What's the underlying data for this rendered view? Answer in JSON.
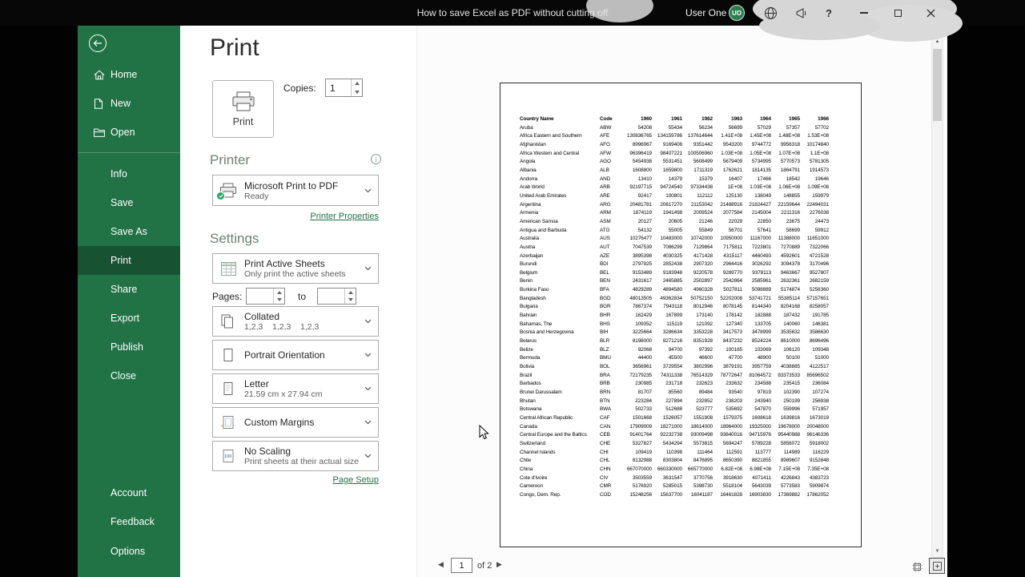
{
  "titlebar": {
    "title": "How to save Excel as PDF without cutting off",
    "user_name": "User One",
    "user_initials": "UO",
    "help_label": "?"
  },
  "sidebar": {
    "top": [
      {
        "label": "Home"
      },
      {
        "label": "New"
      },
      {
        "label": "Open"
      }
    ],
    "middle": [
      {
        "label": "Info"
      },
      {
        "label": "Save"
      },
      {
        "label": "Save As"
      },
      {
        "label": "Print"
      },
      {
        "label": "Share"
      },
      {
        "label": "Export"
      },
      {
        "label": "Publish"
      },
      {
        "label": "Close"
      }
    ],
    "bottom": [
      {
        "label": "Account"
      },
      {
        "label": "Feedback"
      },
      {
        "label": "Options"
      }
    ],
    "selected": "Print"
  },
  "print_panel": {
    "title": "Print",
    "print_button_label": "Print",
    "copies_label": "Copies:",
    "copies_value": "1",
    "printer_heading": "Printer",
    "printer_name": "Microsoft Print to PDF",
    "printer_status": "Ready",
    "printer_properties_link": "Printer Properties",
    "settings_heading": "Settings",
    "pages_label": "Pages:",
    "pages_to_label": "to",
    "pages_from_value": "",
    "pages_to_value": "",
    "dropdowns": [
      {
        "label": "Print Active Sheets",
        "sublabel": "Only print the active sheets"
      },
      {
        "label": "Collated",
        "sublabel": "1,2,3    1,2,3    1,2,3"
      },
      {
        "label": "Portrait Orientation",
        "sublabel": ""
      },
      {
        "label": "Letter",
        "sublabel": "21.59 cm x 27.94 cm"
      },
      {
        "label": "Custom Margins",
        "sublabel": ""
      },
      {
        "label": "No Scaling",
        "sublabel": "Print sheets at their actual size"
      }
    ],
    "page_setup_link": "Page Setup",
    "accent_color": "#217346"
  },
  "preview": {
    "nav": {
      "current_page": "1",
      "of_label": "of 2"
    },
    "table": {
      "headers": [
        "Country Name",
        "Code",
        "1960",
        "1961",
        "1962",
        "1963",
        "1964",
        "1965",
        "1966"
      ],
      "rows": [
        [
          "Aruba",
          "ABW",
          "54208",
          "55434",
          "56234",
          "56699",
          "57029",
          "57357",
          "57702"
        ],
        [
          "Africa Eastern and Southern",
          "AFE",
          "130836765",
          "134159786",
          "137614644",
          "1.41E+08",
          "1.45E+08",
          "1.48E+08",
          "1.53E+08"
        ],
        [
          "Afghanistan",
          "AFG",
          "8996967",
          "9169406",
          "9351442",
          "9543200",
          "9744772",
          "9956318",
          "10174840"
        ],
        [
          "Africa Western and Central",
          "AFW",
          "96396419",
          "98407221",
          "100506960",
          "1.03E+08",
          "1.05E+08",
          "1.07E+08",
          "1.1E+08"
        ],
        [
          "Angola",
          "AGO",
          "5454938",
          "5531451",
          "5608499",
          "5679409",
          "5734995",
          "5770573",
          "5781305"
        ],
        [
          "Albania",
          "ALB",
          "1608800",
          "1659800",
          "1711319",
          "1762621",
          "1814135",
          "1864791",
          "1914573"
        ],
        [
          "Andorra",
          "AND",
          "13410",
          "14379",
          "15379",
          "16407",
          "17466",
          "18542",
          "19646"
        ],
        [
          "Arab World",
          "ARB",
          "92197715",
          "94724540",
          "97334438",
          "1E+08",
          "1.03E+08",
          "1.06E+08",
          "1.09E+08"
        ],
        [
          "United Arab Emirates",
          "ARE",
          "92417",
          "100801",
          "112112",
          "125130",
          "138049",
          "148855",
          "159979"
        ],
        [
          "Argentina",
          "ARG",
          "20481781",
          "20817270",
          "21153042",
          "21488916",
          "21824427",
          "22159644",
          "22494031"
        ],
        [
          "Armenia",
          "ARM",
          "1874119",
          "1941498",
          "2009524",
          "2077584",
          "2145004",
          "2211316",
          "2276038"
        ],
        [
          "American Samoa",
          "ASM",
          "20127",
          "20605",
          "21246",
          "22029",
          "22850",
          "23675",
          "24473"
        ],
        [
          "Antigua and Barbuda",
          "ATG",
          "54132",
          "55005",
          "55849",
          "56701",
          "57641",
          "58699",
          "59912"
        ],
        [
          "Australia",
          "AUS",
          "10276477",
          "10483000",
          "10742000",
          "10950000",
          "11167000",
          "11388000",
          "11651000"
        ],
        [
          "Austria",
          "AUT",
          "7047539",
          "7086299",
          "7129864",
          "7175811",
          "7223801",
          "7270889",
          "7322066"
        ],
        [
          "Azerbaijan",
          "AZE",
          "3895398",
          "4030325",
          "4171428",
          "4315117",
          "4460493",
          "4592601",
          "4721528"
        ],
        [
          "Burundi",
          "BDI",
          "2797925",
          "2852438",
          "2907320",
          "2964416",
          "3026292",
          "3094378",
          "3170496"
        ],
        [
          "Belgium",
          "BEL",
          "9153489",
          "9183948",
          "9220578",
          "9289770",
          "9378113",
          "9463667",
          "9527807"
        ],
        [
          "Benin",
          "BEN",
          "2431617",
          "2465885",
          "2502897",
          "2542864",
          "2585961",
          "2632361",
          "2682159"
        ],
        [
          "Burkina Faso",
          "BFA",
          "4829289",
          "4894580",
          "4960328",
          "5027811",
          "5098889",
          "5174874",
          "5256360"
        ],
        [
          "Bangladesh",
          "BGD",
          "48013505",
          "49362834",
          "50752150",
          "52202008",
          "53741721",
          "55385114",
          "57157651"
        ],
        [
          "Bulgaria",
          "BGR",
          "7867374",
          "7943118",
          "8012946",
          "8078145",
          "8144340",
          "8204168",
          "8258057"
        ],
        [
          "Bahrain",
          "BHR",
          "162429",
          "167899",
          "173140",
          "178142",
          "182888",
          "187432",
          "191785"
        ],
        [
          "Bahamas, The",
          "BHS",
          "109352",
          "115119",
          "121092",
          "127340",
          "133705",
          "140060",
          "146381"
        ],
        [
          "Bosnia and Herzegovina",
          "BIH",
          "3225664",
          "3286634",
          "3353228",
          "3417573",
          "3478999",
          "3535632",
          "3586630"
        ],
        [
          "Belarus",
          "BLR",
          "8198000",
          "8271216",
          "8351928",
          "8437232",
          "8524224",
          "8610000",
          "8696496"
        ],
        [
          "Belize",
          "BLZ",
          "92068",
          "94700",
          "97392",
          "100165",
          "103069",
          "106120",
          "109348"
        ],
        [
          "Bermuda",
          "BMU",
          "44400",
          "45500",
          "46600",
          "47700",
          "48900",
          "50100",
          "51000"
        ],
        [
          "Bolivia",
          "BOL",
          "3656961",
          "3729554",
          "3802996",
          "3879191",
          "3957759",
          "4038885",
          "4122517"
        ],
        [
          "Brazil",
          "BRA",
          "72179235",
          "74311338",
          "76514329",
          "78772647",
          "81064572",
          "83373533",
          "85696502"
        ],
        [
          "Barbados",
          "BRB",
          "230985",
          "231718",
          "232623",
          "233632",
          "234588",
          "235415",
          "236084"
        ],
        [
          "Brunei Darussalam",
          "BRN",
          "81707",
          "85560",
          "89484",
          "93540",
          "97819",
          "102390",
          "107274"
        ],
        [
          "Bhutan",
          "BTN",
          "223284",
          "227894",
          "232852",
          "238203",
          "243940",
          "250199",
          "256938"
        ],
        [
          "Botswana",
          "BWA",
          "502733",
          "512688",
          "523777",
          "535692",
          "547870",
          "559996",
          "571957"
        ],
        [
          "Central African Republic",
          "CAF",
          "1501668",
          "1526057",
          "1551908",
          "1579375",
          "1608618",
          "1639816",
          "1673019"
        ],
        [
          "Canada",
          "CAN",
          "17909009",
          "18271000",
          "18614000",
          "18964000",
          "19325000",
          "19678000",
          "20048000"
        ],
        [
          "Central Europe and the Baltics",
          "CEB",
          "91401764",
          "92232738",
          "93009498",
          "93840016",
          "94715976",
          "95440988",
          "96146336"
        ],
        [
          "Switzerland",
          "CHE",
          "5327827",
          "5434294",
          "5573815",
          "5694247",
          "5789228",
          "5856072",
          "5918002"
        ],
        [
          "Channel Islands",
          "CHI",
          "109419",
          "110398",
          "111464",
          "112591",
          "113777",
          "114989",
          "116229"
        ],
        [
          "Chile",
          "CHL",
          "8132988",
          "8303804",
          "8476895",
          "8650390",
          "8821855",
          "8989607",
          "9152848"
        ],
        [
          "China",
          "CHN",
          "667070000",
          "660330000",
          "665770000",
          "6.82E+08",
          "6.98E+08",
          "7.15E+08",
          "7.35E+08"
        ],
        [
          "Cote d'Ivoire",
          "CIV",
          "3503559",
          "3631547",
          "3770756",
          "3918630",
          "4071411",
          "4226843",
          "4383723"
        ],
        [
          "Cameroon",
          "CMR",
          "5176920",
          "5285015",
          "5398730",
          "5518104",
          "5643039",
          "5773583",
          "5909874"
        ],
        [
          "Congo, Dem. Rep.",
          "COD",
          "15248256",
          "15637700",
          "16041187",
          "16461828",
          "16903830",
          "17369882",
          "17862052"
        ]
      ]
    }
  }
}
